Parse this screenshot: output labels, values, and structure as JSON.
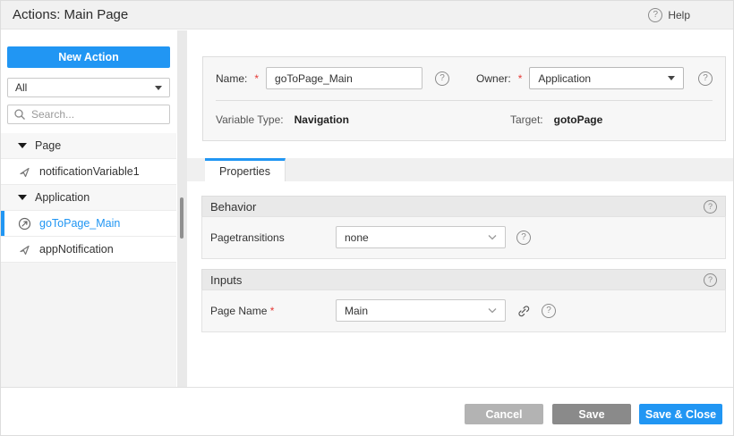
{
  "ui": {
    "required_mark": "*"
  },
  "header": {
    "title": "Actions: Main Page",
    "help_label": "Help"
  },
  "sidebar": {
    "new_action_label": "New Action",
    "filter_value": "All",
    "search_placeholder": "Search...",
    "tree": [
      {
        "type": "group",
        "label": "Page"
      },
      {
        "type": "item",
        "label": "notificationVariable1",
        "icon": "notification"
      },
      {
        "type": "group",
        "label": "Application"
      },
      {
        "type": "item",
        "label": "goToPage_Main",
        "icon": "navigation",
        "selected": true
      },
      {
        "type": "item",
        "label": "appNotification",
        "icon": "notification"
      }
    ]
  },
  "form": {
    "name": {
      "label": "Name:",
      "required": true,
      "value": "goToPage_Main"
    },
    "owner": {
      "label": "Owner:",
      "required": true,
      "value": "Application"
    },
    "variable_type": {
      "label": "Variable Type:",
      "value": "Navigation"
    },
    "target": {
      "label": "Target:",
      "value": "gotoPage"
    }
  },
  "tabs": [
    {
      "label": "Properties",
      "active": true
    }
  ],
  "sections": [
    {
      "title": "Behavior",
      "field_label": "Pagetransitions",
      "field_required": false,
      "field_value": "none"
    },
    {
      "title": "Inputs",
      "field_label": "Page Name",
      "field_required": true,
      "field_value": "Main"
    }
  ],
  "footer": {
    "cancel_label": "Cancel",
    "save_label": "Save",
    "save_close_label": "Save & Close"
  },
  "colors": {
    "accent_blue": "#2196f3",
    "header_bg": "#f1f1f1",
    "panel_bg": "#f7f7f7",
    "section_header_bg": "#e9e9e9",
    "cancel_gray": "#b3b3b3",
    "save_gray": "#8a8a8a",
    "required_red": "#e53935",
    "selected_text": "#2196f3"
  }
}
